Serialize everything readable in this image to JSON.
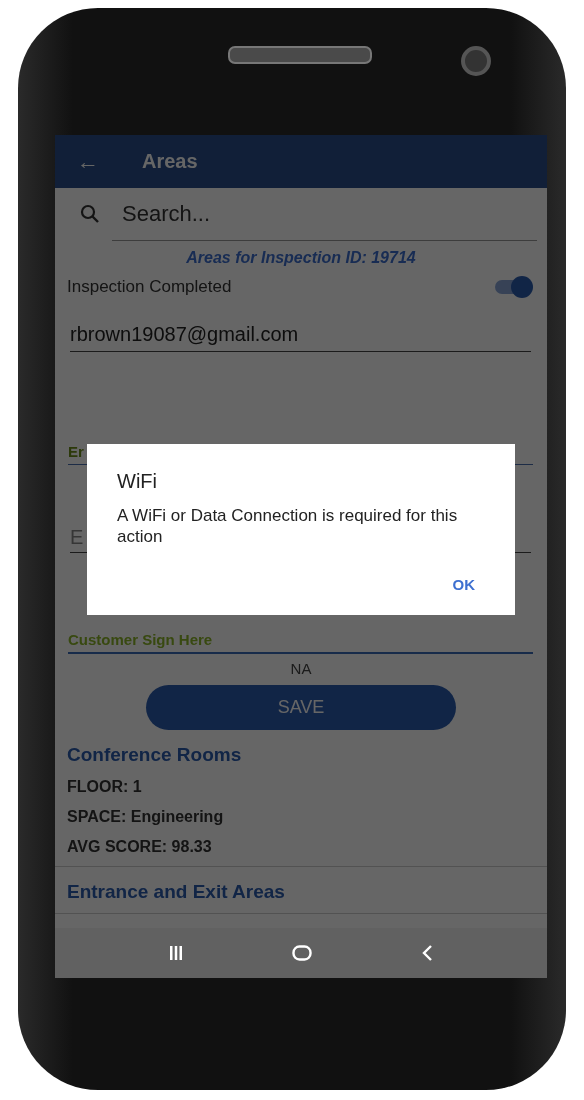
{
  "app_bar": {
    "back_icon": "←",
    "title": "Areas"
  },
  "search": {
    "placeholder": "Search..."
  },
  "subtitle": "Areas for Inspection ID: 19714",
  "inspection_completed": {
    "label": "Inspection Completed",
    "on": true
  },
  "email_field": {
    "value": "rbrown19087@gmail.com"
  },
  "field_2": {
    "label": "Er"
  },
  "field_3": {
    "placeholder": "E"
  },
  "signature": {
    "label": "Customer Sign Here",
    "value": "NA"
  },
  "save_button": "SAVE",
  "areas": [
    {
      "name": "Conference Rooms",
      "details": [
        "FLOOR: 1",
        "SPACE: Engineering",
        "AVG SCORE: 98.33"
      ]
    },
    {
      "name": "Entrance and Exit Areas"
    }
  ],
  "dialog": {
    "title": "WiFi",
    "message": "A WiFi or Data Connection is required for this action",
    "button": "OK"
  }
}
